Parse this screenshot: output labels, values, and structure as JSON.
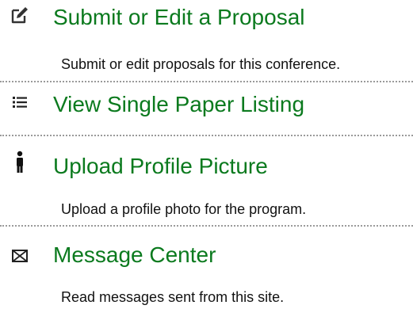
{
  "menu": {
    "items": [
      {
        "icon": "edit-icon",
        "title": "Submit or Edit a Proposal",
        "description": "Submit or edit proposals for this conference."
      },
      {
        "icon": "list-icon",
        "title": "View Single Paper Listing",
        "description": ""
      },
      {
        "icon": "person-icon",
        "title": "Upload Profile Picture",
        "description": "Upload a profile photo for the program."
      },
      {
        "icon": "envelope-icon",
        "title": "Message Center",
        "description": "Read messages sent from this site."
      }
    ]
  },
  "colors": {
    "link": "#0b7a1e",
    "text": "#111111",
    "divider": "#9a9a9a"
  }
}
